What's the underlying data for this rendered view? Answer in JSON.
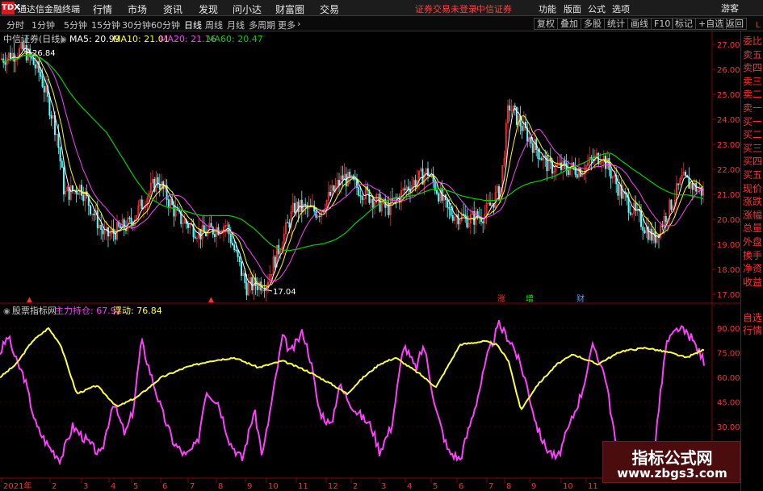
{
  "app": {
    "title": "通达信金融终端",
    "logo": "TDX"
  },
  "menu": [
    "行情",
    "市场",
    "资讯",
    "发现",
    "问小达",
    "财富圈",
    "交易"
  ],
  "status": {
    "login": "证券交易未登录",
    "broker": "中信证券"
  },
  "right_menu": [
    "功能",
    "版面",
    "公式",
    "选项"
  ],
  "guest": "游客",
  "timeframes": [
    "分时",
    "1分钟",
    "5分钟",
    "15分钟",
    "30分钟",
    "60分钟",
    "日线",
    "周线",
    "月线",
    "多周期",
    "更多"
  ],
  "active_timeframe": "日线",
  "toolbar_right": [
    "复权",
    "叠加",
    "多股",
    "统计",
    "画线",
    "F10",
    "标记",
    "+自选",
    "返回"
  ],
  "stock": {
    "name": "中信证券(日线)"
  },
  "ma": {
    "ma5": "MA5: 20.99",
    "ma10": "MA10: 21.01",
    "ma20": "MA20: 21.16",
    "ma60": "MA60: 20.47"
  },
  "price_axis": [
    "27.00",
    "26.00",
    "25.00",
    "24.00",
    "23.00",
    "22.00",
    "21.00",
    "20.00",
    "19.00",
    "18.00",
    "17.00"
  ],
  "annotations": {
    "high": "26.84",
    "low": "17.04"
  },
  "indicator": {
    "name": "股票指标网",
    "main": "主力持仓: 67.92",
    "float": "浮动: 76.84",
    "axis": [
      "90.00",
      "75.00",
      "60.00",
      "45.00",
      "30.00"
    ]
  },
  "markers": [
    "涨",
    "增",
    "财"
  ],
  "x_axis": [
    "2021年",
    "2",
    "3",
    "4",
    "5",
    "6",
    "7",
    "8",
    "9",
    "10",
    "11",
    "12",
    "2",
    "3",
    "4",
    "5",
    "6",
    "7",
    "8",
    "9",
    "10",
    "11"
  ],
  "side_panel": [
    "委比",
    "卖五",
    "卖四",
    "卖三",
    "卖二",
    "卖一",
    "买一",
    "买二",
    "买三",
    "买四",
    "买五",
    "现价",
    "涨跌",
    "涨幅",
    "总量",
    "外盘",
    "换手",
    "净资",
    "收益"
  ],
  "side_panel_bottom": [
    "自选",
    "行情"
  ],
  "side_panel_corner": "L",
  "watermark": {
    "line1": "指标公式网",
    "line2": "www.zbgs3.com"
  },
  "colors": {
    "up": "#ff3030",
    "down": "#54ffff",
    "ma5": "#ffffff",
    "ma10": "#ffff00",
    "ma20": "#ff40ff",
    "ma60": "#00d000",
    "main_line": "#ff40ff",
    "float_line": "#ffff40"
  }
}
